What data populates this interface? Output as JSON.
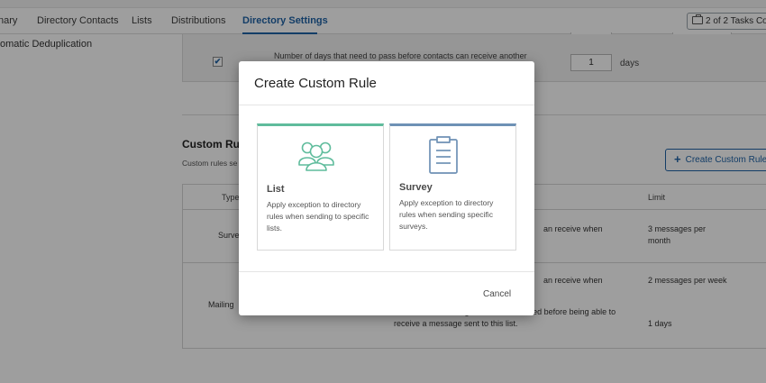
{
  "tabs": [
    {
      "label": "nary",
      "active": false
    },
    {
      "label": "Directory Contacts",
      "active": false
    },
    {
      "label": "Lists",
      "active": false
    },
    {
      "label": "Distributions",
      "active": false
    },
    {
      "label": "Directory Settings",
      "active": true
    }
  ],
  "tasks_button": "2 of 2 Tasks Com",
  "sidebar": {
    "item": "omatic Deduplication"
  },
  "settings": {
    "checkbox_checked": true,
    "note": "Number of days that need to pass before contacts can receive another",
    "days_value": "1",
    "days_unit": "days"
  },
  "custom_rules": {
    "title": "Custom Rule",
    "description": "Custom rules se",
    "create_button": "Create Custom Rule",
    "columns": {
      "type": "Type",
      "limit": "Limit"
    },
    "rows": [
      {
        "type": "Surve",
        "rule": "an receive when",
        "limit": "3 messages per month"
      },
      {
        "type": "Mailing",
        "rule": "an receive when",
        "limit": "2 messages per week",
        "rule2": "after the last message a contact received before being able to receive a message sent to this list.",
        "limit2": "1 days"
      }
    ]
  },
  "modal": {
    "title": "Create Custom Rule",
    "cards": [
      {
        "title": "List",
        "description": "Apply exception to directory rules when sending to specific lists.",
        "icon": "people-group-icon",
        "accent": "#5fbc9c"
      },
      {
        "title": "Survey",
        "description": "Apply exception to directory rules when sending specific surveys.",
        "icon": "clipboard-icon",
        "accent": "#6e91b5"
      }
    ],
    "cancel_label": "Cancel"
  },
  "colors": {
    "brand_blue": "#1f63a7",
    "overlay": "rgba(0,0,0,0.38)"
  }
}
